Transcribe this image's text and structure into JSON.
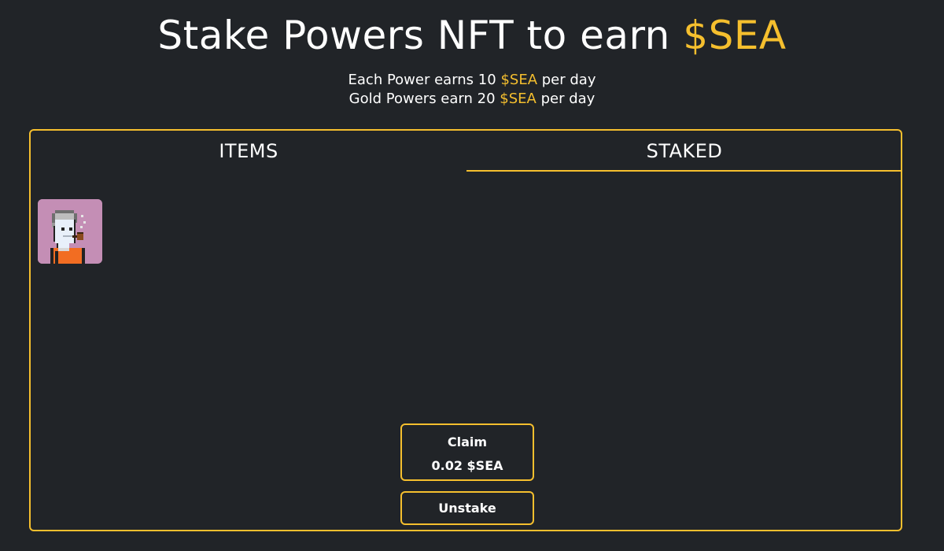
{
  "header": {
    "title_prefix": "Stake Powers NFT to earn",
    "title_token": "$SEA",
    "line1_prefix": "Each Power earns 10",
    "line1_token": "$SEA",
    "line1_suffix": "per day",
    "line2_prefix": "Gold Powers earn 20",
    "line2_token": "$SEA",
    "line2_suffix": "per day"
  },
  "tabs": [
    {
      "label": "ITEMS",
      "active": false
    },
    {
      "label": "STAKED",
      "active": true
    }
  ],
  "items": [
    {
      "icon": "pixel-character-nft-icon",
      "background": "#c48eb5"
    }
  ],
  "actions": {
    "claim_label": "Claim",
    "claim_amount": "0.02 $SEA",
    "unstake_label": "Unstake"
  },
  "colors": {
    "background": "#212428",
    "accent": "#f5bf2e",
    "text": "#ffffff"
  }
}
